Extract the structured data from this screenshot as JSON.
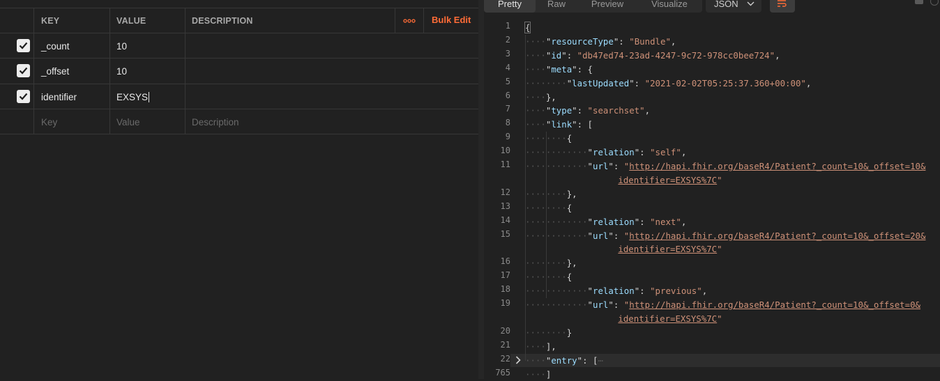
{
  "params": {
    "headers": {
      "key": "KEY",
      "value": "VALUE",
      "description": "DESCRIPTION"
    },
    "more_label": "ooo",
    "bulk_edit_label": "Bulk Edit",
    "rows": [
      {
        "checked": true,
        "key": "_count",
        "value": "10",
        "description": ""
      },
      {
        "checked": true,
        "key": "_offset",
        "value": "10",
        "description": ""
      },
      {
        "checked": true,
        "key": "identifier",
        "value": "EXSYS",
        "description": ""
      }
    ],
    "placeholder": {
      "key": "Key",
      "value": "Value",
      "description": "Description"
    }
  },
  "response": {
    "tabs": [
      "Pretty",
      "Raw",
      "Preview",
      "Visualize"
    ],
    "active_tab": "Pretty",
    "format": "JSON",
    "lines": [
      {
        "n": "1",
        "t": "{"
      },
      {
        "n": "2",
        "key": "resourceType",
        "val": "Bundle"
      },
      {
        "n": "3",
        "key": "id",
        "val": "db47ed74-23ad-4247-9c72-978cc0bee724"
      },
      {
        "n": "4",
        "key": "meta",
        "open": "{"
      },
      {
        "n": "5",
        "key": "lastUpdated",
        "val": "2021-02-02T05:25:37.360+00:00"
      },
      {
        "n": "6",
        "t": "},"
      },
      {
        "n": "7",
        "key": "type",
        "val": "searchset"
      },
      {
        "n": "8",
        "key": "link",
        "open": "["
      },
      {
        "n": "9",
        "t": "{"
      },
      {
        "n": "10",
        "key": "relation",
        "val": "self"
      },
      {
        "n": "11",
        "key": "url",
        "url1": "http://hapi.fhir.org/baseR4/Patient?_count=10&_offset=10&",
        "url2": "identifier=EXSYS%7C"
      },
      {
        "n": "12",
        "t": "},"
      },
      {
        "n": "13",
        "t": "{"
      },
      {
        "n": "14",
        "key": "relation",
        "val": "next"
      },
      {
        "n": "15",
        "key": "url",
        "url1": "http://hapi.fhir.org/baseR4/Patient?_count=10&_offset=20&",
        "url2": "identifier=EXSYS%7C"
      },
      {
        "n": "16",
        "t": "},"
      },
      {
        "n": "17",
        "t": "{"
      },
      {
        "n": "18",
        "key": "relation",
        "val": "previous"
      },
      {
        "n": "19",
        "key": "url",
        "url1": "http://hapi.fhir.org/baseR4/Patient?_count=10&_offset=0&",
        "url2": "identifier=EXSYS%7C"
      },
      {
        "n": "20",
        "t": "}"
      },
      {
        "n": "21",
        "t": "],"
      },
      {
        "n": "22",
        "key": "entry",
        "open": "[",
        "collapsed": "⋯"
      },
      {
        "n": "765",
        "t": "]"
      }
    ]
  },
  "colors": {
    "accent": "#ff6c37",
    "key": "#9cdcfe",
    "string": "#ce9178"
  }
}
